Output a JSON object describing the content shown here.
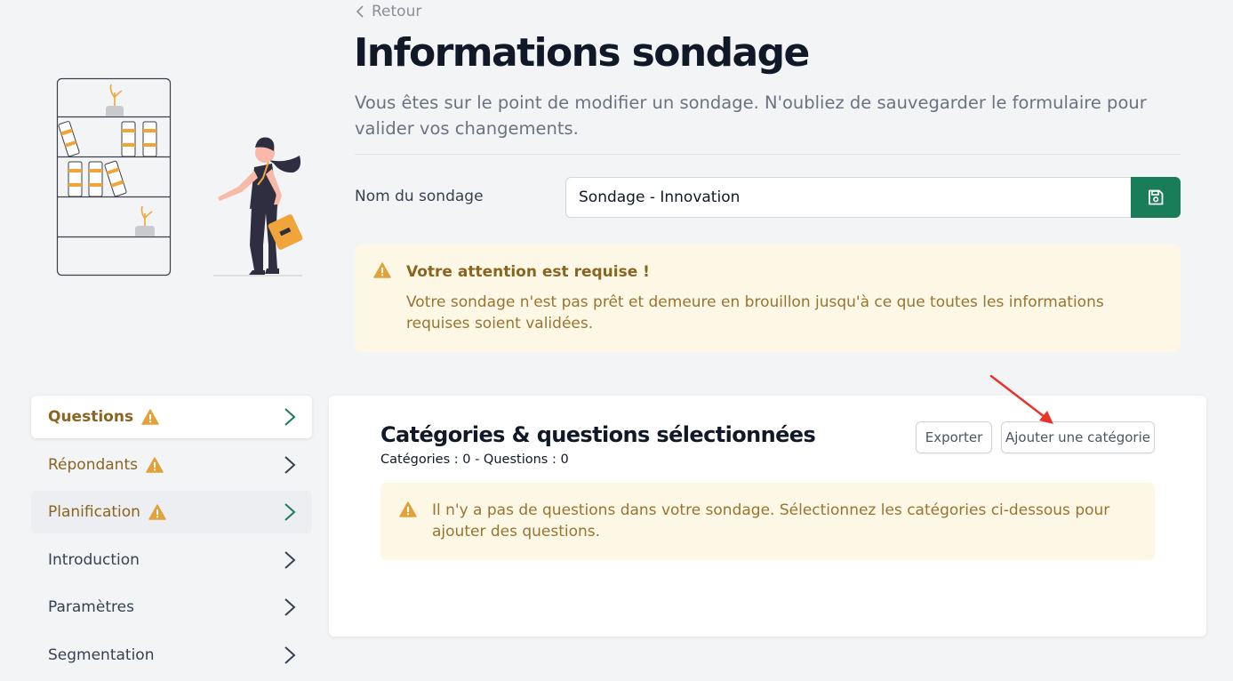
{
  "header": {
    "back_label": "Retour",
    "title": "Informations sondage",
    "description": "Vous êtes sur le point de modifier un sondage. N'oubliez de sauvegarder le formulaire pour valider vos changements."
  },
  "form": {
    "name_label": "Nom du sondage",
    "name_value": "Sondage - Innovation"
  },
  "top_alert": {
    "title": "Votre attention est requise !",
    "body": "Votre sondage n'est pas prêt et demeure en brouillon jusqu'à ce que toutes les informations requises soient validées."
  },
  "nav": {
    "items": [
      {
        "label": "Questions",
        "warning": true,
        "state": "active"
      },
      {
        "label": "Répondants",
        "warning": true,
        "state": "normal"
      },
      {
        "label": "Planification",
        "warning": true,
        "state": "hover"
      },
      {
        "label": "Introduction",
        "warning": false,
        "state": "normal"
      },
      {
        "label": "Paramètres",
        "warning": false,
        "state": "normal"
      },
      {
        "label": "Segmentation",
        "warning": false,
        "state": "normal"
      }
    ]
  },
  "card": {
    "title": "Catégories & questions sélectionnées",
    "counts": "Catégories : 0 - Questions : 0",
    "export_label": "Exporter",
    "add_label": "Ajouter une catégorie",
    "alert_body": "Il n'y a pas de questions dans votre sondage. Sélectionnez les catégories ci-dessous pour ajouter des questions."
  },
  "colors": {
    "accent_green": "#1a7d5a",
    "warning_amber": "#e0a23a",
    "alert_bg": "#fdf8e6",
    "annotation_red": "#e8322a"
  },
  "icons": {
    "back": "chevron-left-icon",
    "save": "save-icon",
    "warning": "warning-triangle-icon",
    "nav": "chevron-right-icon"
  }
}
